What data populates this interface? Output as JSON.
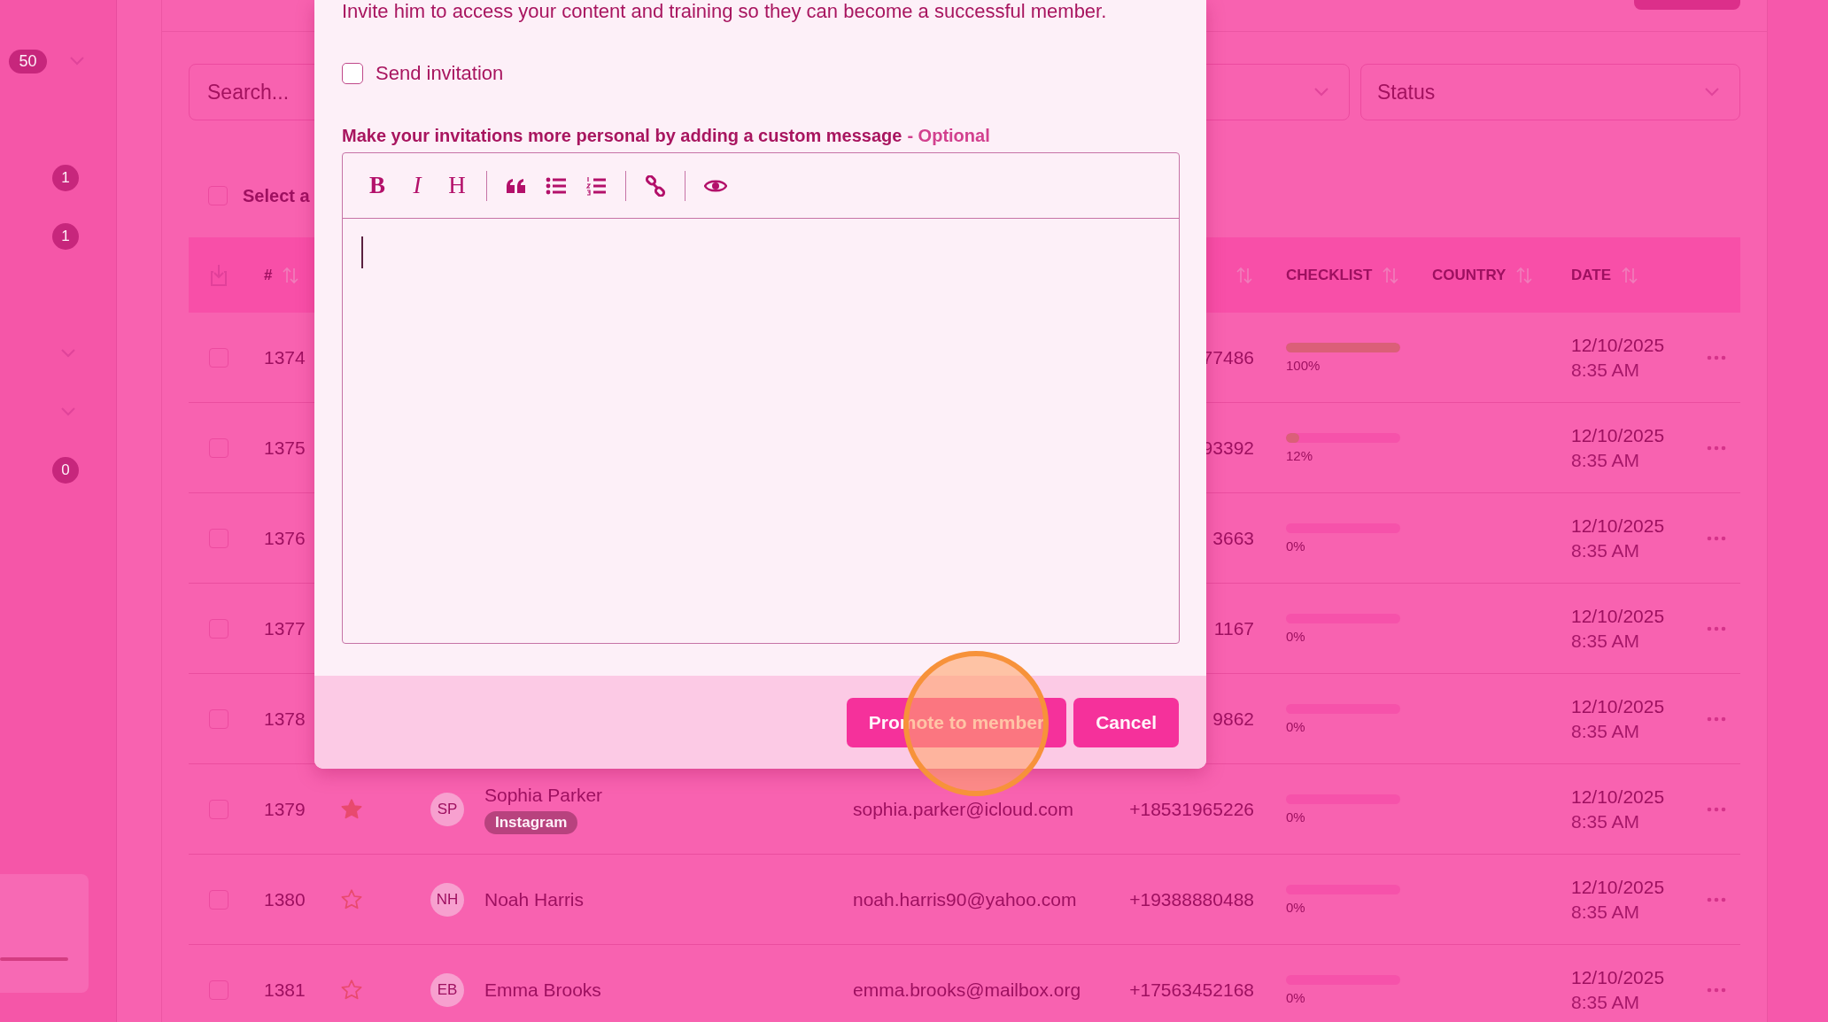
{
  "sidebar": {
    "groups": [
      [
        {
          "kind": "badge_select",
          "label": "50"
        }
      ],
      [
        {
          "kind": "badge",
          "label": "1"
        },
        {
          "kind": "badge",
          "label": "1"
        }
      ],
      [
        {
          "kind": "chevron"
        },
        {
          "kind": "chevron"
        },
        {
          "kind": "badge",
          "label": "0"
        }
      ]
    ]
  },
  "filters": {
    "search": {
      "placeholder": "Search..."
    },
    "status": {
      "value": "Status"
    }
  },
  "select_all": {
    "checked": false,
    "label": "Select a"
  },
  "table": {
    "columns": [
      {
        "kind": "download"
      },
      {
        "kind": "label",
        "label": "#",
        "sortable": true
      },
      {
        "kind": "blank"
      },
      {
        "kind": "blank"
      },
      {
        "kind": "blank"
      },
      {
        "kind": "blank"
      },
      {
        "kind": "sort",
        "sortable": true
      },
      {
        "kind": "label",
        "label": "CHECKLIST",
        "sortable": true
      },
      {
        "kind": "label",
        "label": "COUNTRY",
        "sortable": true
      },
      {
        "kind": "label",
        "label": "DATE",
        "sortable": true
      },
      {
        "kind": "blank"
      }
    ],
    "rows": [
      {
        "checked": false,
        "number": "1374",
        "phone": "77486",
        "checklist": {
          "level": 1,
          "reading": "100%"
        },
        "date": "12/10/2025",
        "time": "8:35 AM"
      },
      {
        "checked": false,
        "number": "1375",
        "phone": "93392",
        "checklist": {
          "level": 0.12,
          "reading": "12%"
        },
        "date": "12/10/2025",
        "time": "8:35 AM"
      },
      {
        "checked": false,
        "number": "1376",
        "phone": "3663",
        "checklist": {
          "level": 0,
          "reading": "0%"
        },
        "date": "12/10/2025",
        "time": "8:35 AM"
      },
      {
        "checked": false,
        "number": "1377",
        "phone": "1167",
        "checklist": {
          "level": 0,
          "reading": "0%"
        },
        "date": "12/10/2025",
        "time": "8:35 AM"
      },
      {
        "checked": false,
        "number": "1378",
        "phone": "9862",
        "checklist": {
          "level": 0,
          "reading": "0%"
        },
        "date": "12/10/2025",
        "time": "8:35 AM"
      },
      {
        "checked": false,
        "number": "1379",
        "starred": true,
        "avatar": "SP",
        "name": "Sophia Parker",
        "tag": "Instagram",
        "email": "sophia.parker@icloud.com",
        "phone": "+18531965226",
        "checklist": {
          "level": 0,
          "reading": "0%"
        },
        "date": "12/10/2025",
        "time": "8:35 AM"
      },
      {
        "checked": false,
        "number": "1380",
        "starred": false,
        "avatar": "NH",
        "name": "Noah Harris",
        "email": "noah.harris90@yahoo.com",
        "phone": "+19388880488",
        "checklist": {
          "level": 0,
          "reading": "0%"
        },
        "date": "12/10/2025",
        "time": "8:35 AM"
      },
      {
        "checked": false,
        "number": "1381",
        "starred": false,
        "avatar": "EB",
        "name": "Emma Brooks",
        "email": "emma.brooks@mailbox.org",
        "phone": "+17563452168",
        "checklist": {
          "level": 0,
          "reading": "0%"
        },
        "date": "12/10/2025",
        "time": "8:35 AM"
      }
    ]
  },
  "modal": {
    "intro": "Invite him to access your content and training so they can become a successful member.",
    "send_invitation": {
      "label": "Send invitation",
      "checked": false
    },
    "message_label": "Make your invitations more personal by adding a custom message",
    "message_note": "- Optional",
    "toolbar": [
      {
        "kind": "bold",
        "label": "B"
      },
      {
        "kind": "italic",
        "label": "I"
      },
      {
        "kind": "heading",
        "label": "H"
      },
      {
        "kind": "separator"
      },
      {
        "kind": "quote"
      },
      {
        "kind": "bullet_list"
      },
      {
        "kind": "numbered_list"
      },
      {
        "kind": "separator"
      },
      {
        "kind": "link"
      },
      {
        "kind": "separator"
      },
      {
        "kind": "preview"
      }
    ],
    "buttons": [
      {
        "kind": "primary",
        "label": "Promote to member"
      },
      {
        "kind": "primary",
        "label": "Cancel"
      }
    ]
  }
}
